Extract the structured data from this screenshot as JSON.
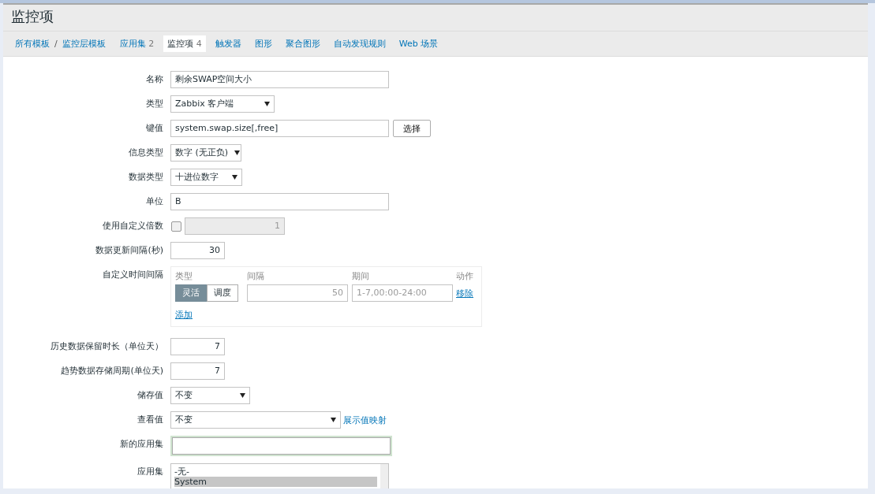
{
  "page": {
    "title": "监控项"
  },
  "breadcrumbs": [
    {
      "label": "所有模板"
    },
    {
      "label": "监控层模板"
    }
  ],
  "breadcrumb_separator": "/",
  "tabs": [
    {
      "label": "应用集",
      "count": "2",
      "selected": false
    },
    {
      "label": "监控项",
      "count": "4",
      "selected": true
    },
    {
      "label": "触发器",
      "selected": false
    },
    {
      "label": "图形",
      "selected": false
    },
    {
      "label": "聚合图形",
      "selected": false
    },
    {
      "label": "自动发现规则",
      "selected": false
    },
    {
      "label": "Web 场景",
      "selected": false
    }
  ],
  "form": {
    "fields": [
      {
        "kind": "text",
        "label": "名称",
        "value": "剩余SWAP空间大小"
      },
      {
        "kind": "select",
        "label": "类型",
        "value": "Zabbix 客户端"
      },
      {
        "kind": "text_button",
        "label": "键值",
        "value": "system.swap.size[,free]",
        "button": "选择"
      },
      {
        "kind": "select",
        "label": "信息类型",
        "value": "数字 (无正负)"
      },
      {
        "kind": "select",
        "label": "数据类型",
        "value": "十进位数字"
      },
      {
        "kind": "text",
        "label": "单位",
        "value": "B"
      },
      {
        "kind": "checkbox_number",
        "label": "使用自定义倍数",
        "checked": false,
        "value": "1",
        "disabled": true
      },
      {
        "kind": "number",
        "label": "数据更新间隔(秒)",
        "value": "30"
      },
      {
        "kind": "intervals",
        "label": "自定义时间间隔",
        "headers": [
          "类型",
          "间隔",
          "期间",
          "动作"
        ],
        "rows": [
          {
            "modes": [
              {
                "label": "灵活",
                "selected": true
              },
              {
                "label": "调度",
                "selected": false
              }
            ],
            "interval_placeholder": "50",
            "period_placeholder": "1-7,00:00-24:00",
            "action": "移除"
          }
        ],
        "add": "添加"
      },
      {
        "kind": "number",
        "label": "历史数据保留时长（单位天）",
        "value": "7"
      },
      {
        "kind": "number",
        "label": "趋势数据存储周期(单位天)",
        "value": "7"
      },
      {
        "kind": "select",
        "label": "储存值",
        "value": "不变"
      },
      {
        "kind": "select_link",
        "label": "查看值",
        "value": "不变",
        "link": "展示值映射"
      },
      {
        "kind": "text",
        "label": "新的应用集",
        "focused": true
      },
      {
        "kind": "listbox",
        "label": "应用集",
        "options": [
          {
            "label": "-无-",
            "selected": false
          },
          {
            "label": "System",
            "selected": true
          }
        ]
      }
    ]
  }
}
